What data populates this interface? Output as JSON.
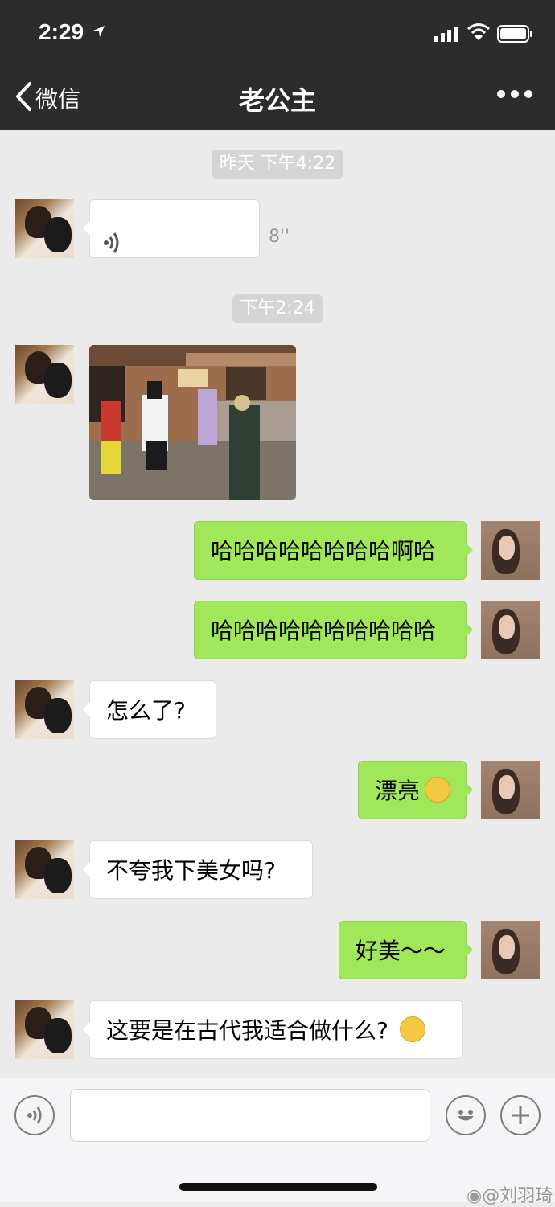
{
  "status_bar": {
    "time": "2:29"
  },
  "nav": {
    "back_label": "微信",
    "title": "老公主"
  },
  "timestamps": [
    "昨天 下午4:22",
    "下午2:24"
  ],
  "voice_message": {
    "duration": "8''"
  },
  "messages": [
    {
      "text": "哈哈哈哈哈哈哈哈啊哈"
    },
    {
      "text": "哈哈哈哈哈哈哈哈哈哈"
    },
    {
      "text": "怎么了?"
    },
    {
      "text": "漂亮"
    },
    {
      "text": "不夸我下美女吗?"
    },
    {
      "text": "好美～～"
    },
    {
      "text": "这要是在古代我适合做什么?"
    }
  ],
  "watermark": "@刘羽琦",
  "colors": {
    "nav_bg": "#2c2c2c",
    "chat_bg": "#ebebeb",
    "outgoing_bubble": "#a0e75a",
    "incoming_bubble": "#ffffff"
  },
  "icons": [
    "location-arrow-icon",
    "signal-icon",
    "wifi-icon",
    "battery-icon",
    "back-chevron-icon",
    "more-icon",
    "voice-wave-icon",
    "smile-emoji-icon",
    "grin-emoji-icon",
    "voice-input-icon",
    "emoji-icon",
    "plus-icon",
    "weibo-icon"
  ]
}
